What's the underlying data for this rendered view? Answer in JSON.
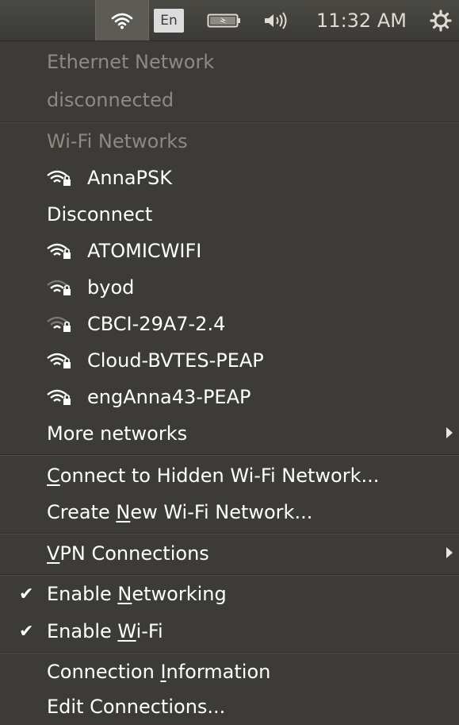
{
  "panel": {
    "keyboard_layout": "En",
    "clock": "11:32 AM",
    "icons": [
      "wifi-icon",
      "keyboard-layout-icon",
      "battery-icon",
      "volume-icon",
      "session-gear-icon"
    ]
  },
  "menu": {
    "ethernet_header": "Ethernet Network",
    "ethernet_status": "disconnected",
    "wifi_header": "Wi-Fi Networks",
    "networks": [
      {
        "ssid": "AnnaPSK",
        "strength": "strong",
        "secured": true
      },
      {
        "ssid": "ATOMICWIFI",
        "strength": "strong",
        "secured": true
      },
      {
        "ssid": "byod",
        "strength": "medium",
        "secured": true
      },
      {
        "ssid": "CBCI-29A7-2.4",
        "strength": "weak",
        "secured": true
      },
      {
        "ssid": "Cloud-BVTES-PEAP",
        "strength": "strong",
        "secured": true
      },
      {
        "ssid": "engAnna43-PEAP",
        "strength": "strong",
        "secured": true
      }
    ],
    "disconnect": "Disconnect",
    "more_networks": "More networks",
    "connect_hidden": {
      "pre": "",
      "mnemonic": "C",
      "post": "onnect to Hidden Wi-Fi Network..."
    },
    "create_new": {
      "pre": "Create ",
      "mnemonic": "N",
      "post": "ew Wi-Fi Network..."
    },
    "vpn": {
      "pre": "",
      "mnemonic": "V",
      "post": "PN Connections"
    },
    "enable_networking": {
      "pre": "Enable ",
      "mnemonic": "N",
      "post": "etworking",
      "checked": true,
      "check_glyph": "✔"
    },
    "enable_wifi": {
      "pre": "Enable ",
      "mnemonic": "W",
      "post": "i-Fi",
      "checked": true,
      "check_glyph": "✔"
    },
    "connection_info": {
      "pre": "Connection ",
      "mnemonic": "I",
      "post": "nformation"
    },
    "edit_connections": "Edit Connections..."
  },
  "colors": {
    "panel_bg": "#3c3b37",
    "menu_bg": "#3c3b37",
    "text": "#ffffff",
    "disabled_text": "#8d8a82"
  }
}
